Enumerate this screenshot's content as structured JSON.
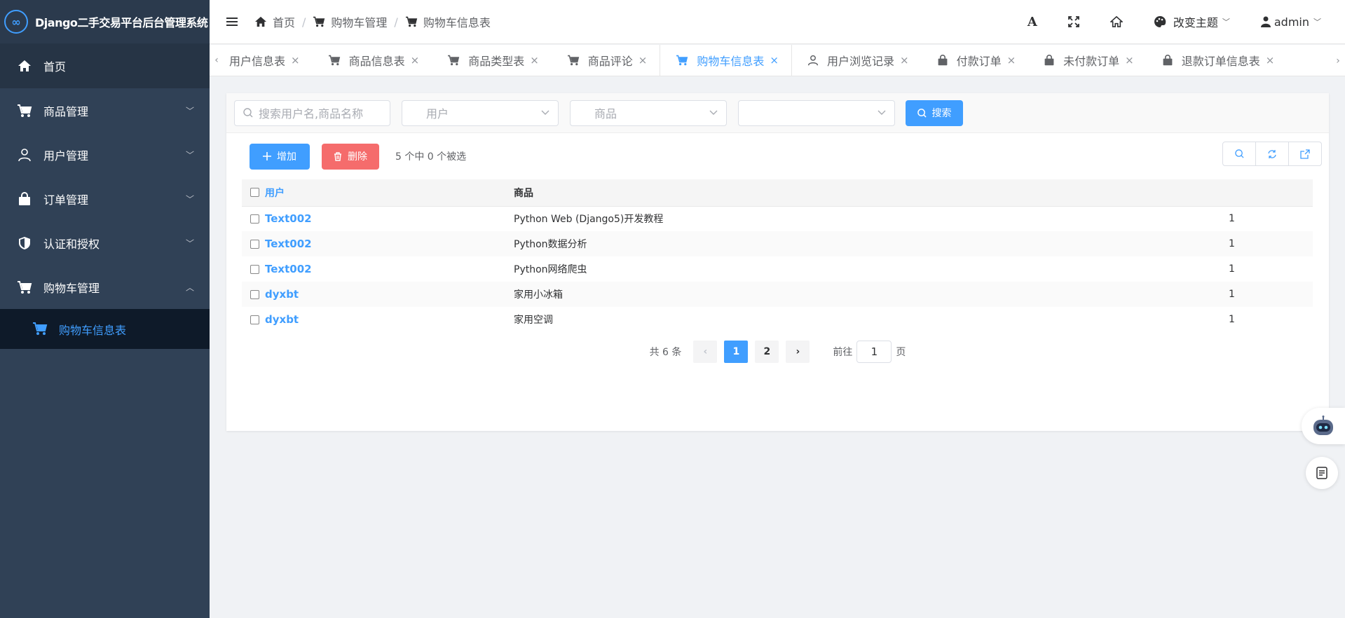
{
  "app": {
    "title": "Django二手交易平台后台管理系统",
    "logo_text": "∞"
  },
  "sidebar": {
    "items": [
      {
        "label": "首页",
        "icon": "home-icon"
      },
      {
        "label": "商品管理",
        "icon": "cart-icon"
      },
      {
        "label": "用户管理",
        "icon": "user-icon"
      },
      {
        "label": "订单管理",
        "icon": "bag-icon"
      },
      {
        "label": "认证和授权",
        "icon": "shield-icon"
      },
      {
        "label": "购物车管理",
        "icon": "cart-icon"
      }
    ],
    "submenu": {
      "label": "购物车信息表",
      "icon": "cart-icon"
    }
  },
  "header": {
    "breadcrumb": [
      "首页",
      "购物车管理",
      "购物车信息表"
    ],
    "theme_label": "改变主题",
    "user": "admin",
    "font_icon_text": "A"
  },
  "tabs": [
    {
      "label": "用户信息表",
      "active": false
    },
    {
      "label": "商品信息表",
      "active": false
    },
    {
      "label": "商品类型表",
      "active": false
    },
    {
      "label": "商品评论",
      "active": false
    },
    {
      "label": "购物车信息表",
      "active": true
    },
    {
      "label": "用户浏览记录",
      "active": false
    },
    {
      "label": "付款订单",
      "active": false
    },
    {
      "label": "未付款订单",
      "active": false
    },
    {
      "label": "退款订单信息表",
      "active": false
    }
  ],
  "filters": {
    "search_placeholder": "搜索用户名,商品名称",
    "user_placeholder": "用户",
    "goods_placeholder": "商品",
    "third_placeholder": "",
    "search_button": "搜索"
  },
  "toolbar": {
    "add_label": "增加",
    "delete_label": "删除",
    "selection_info": "5 个中 0 个被选"
  },
  "table": {
    "columns": [
      "用户",
      "商品",
      ""
    ],
    "rows": [
      {
        "user": "Text002",
        "goods": "Python Web (Django5)开发教程",
        "qty": "1"
      },
      {
        "user": "Text002",
        "goods": "Python数据分析",
        "qty": "1"
      },
      {
        "user": "Text002",
        "goods": "Python网络爬虫",
        "qty": "1"
      },
      {
        "user": "dyxbt",
        "goods": "家用小冰箱",
        "qty": "1"
      },
      {
        "user": "dyxbt",
        "goods": "家用空调",
        "qty": "1"
      }
    ]
  },
  "pagination": {
    "total_label": "共 6 条",
    "pages": [
      "1",
      "2"
    ],
    "current": "1",
    "goto_prefix": "前往",
    "goto_value": "1",
    "goto_suffix": "页"
  },
  "colors": {
    "primary": "#409eff",
    "danger": "#f56c6c",
    "sidebar": "#304156"
  }
}
